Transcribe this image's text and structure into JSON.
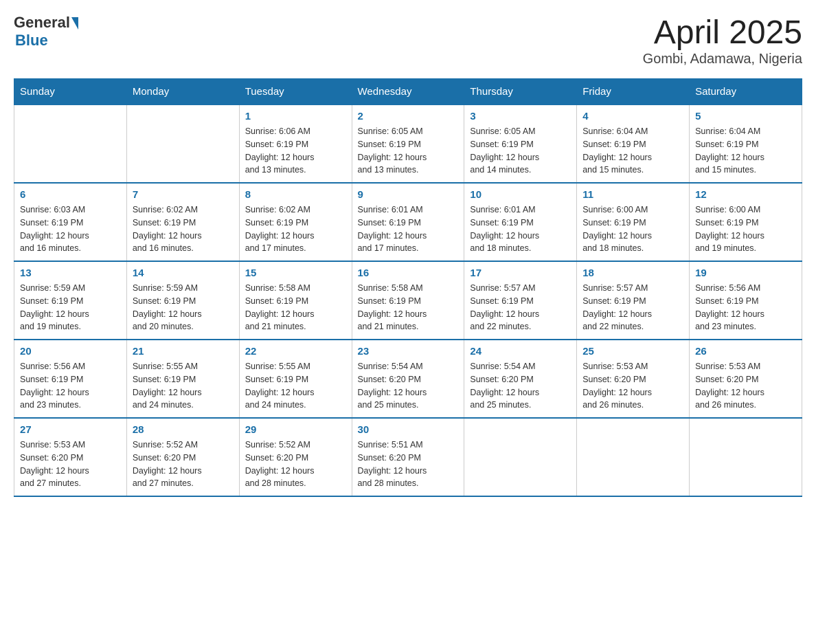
{
  "header": {
    "logo_general": "General",
    "logo_blue": "Blue",
    "title": "April 2025",
    "subtitle": "Gombi, Adamawa, Nigeria"
  },
  "columns": [
    "Sunday",
    "Monday",
    "Tuesday",
    "Wednesday",
    "Thursday",
    "Friday",
    "Saturday"
  ],
  "weeks": [
    [
      {
        "day": "",
        "info": ""
      },
      {
        "day": "",
        "info": ""
      },
      {
        "day": "1",
        "info": "Sunrise: 6:06 AM\nSunset: 6:19 PM\nDaylight: 12 hours\nand 13 minutes."
      },
      {
        "day": "2",
        "info": "Sunrise: 6:05 AM\nSunset: 6:19 PM\nDaylight: 12 hours\nand 13 minutes."
      },
      {
        "day": "3",
        "info": "Sunrise: 6:05 AM\nSunset: 6:19 PM\nDaylight: 12 hours\nand 14 minutes."
      },
      {
        "day": "4",
        "info": "Sunrise: 6:04 AM\nSunset: 6:19 PM\nDaylight: 12 hours\nand 15 minutes."
      },
      {
        "day": "5",
        "info": "Sunrise: 6:04 AM\nSunset: 6:19 PM\nDaylight: 12 hours\nand 15 minutes."
      }
    ],
    [
      {
        "day": "6",
        "info": "Sunrise: 6:03 AM\nSunset: 6:19 PM\nDaylight: 12 hours\nand 16 minutes."
      },
      {
        "day": "7",
        "info": "Sunrise: 6:02 AM\nSunset: 6:19 PM\nDaylight: 12 hours\nand 16 minutes."
      },
      {
        "day": "8",
        "info": "Sunrise: 6:02 AM\nSunset: 6:19 PM\nDaylight: 12 hours\nand 17 minutes."
      },
      {
        "day": "9",
        "info": "Sunrise: 6:01 AM\nSunset: 6:19 PM\nDaylight: 12 hours\nand 17 minutes."
      },
      {
        "day": "10",
        "info": "Sunrise: 6:01 AM\nSunset: 6:19 PM\nDaylight: 12 hours\nand 18 minutes."
      },
      {
        "day": "11",
        "info": "Sunrise: 6:00 AM\nSunset: 6:19 PM\nDaylight: 12 hours\nand 18 minutes."
      },
      {
        "day": "12",
        "info": "Sunrise: 6:00 AM\nSunset: 6:19 PM\nDaylight: 12 hours\nand 19 minutes."
      }
    ],
    [
      {
        "day": "13",
        "info": "Sunrise: 5:59 AM\nSunset: 6:19 PM\nDaylight: 12 hours\nand 19 minutes."
      },
      {
        "day": "14",
        "info": "Sunrise: 5:59 AM\nSunset: 6:19 PM\nDaylight: 12 hours\nand 20 minutes."
      },
      {
        "day": "15",
        "info": "Sunrise: 5:58 AM\nSunset: 6:19 PM\nDaylight: 12 hours\nand 21 minutes."
      },
      {
        "day": "16",
        "info": "Sunrise: 5:58 AM\nSunset: 6:19 PM\nDaylight: 12 hours\nand 21 minutes."
      },
      {
        "day": "17",
        "info": "Sunrise: 5:57 AM\nSunset: 6:19 PM\nDaylight: 12 hours\nand 22 minutes."
      },
      {
        "day": "18",
        "info": "Sunrise: 5:57 AM\nSunset: 6:19 PM\nDaylight: 12 hours\nand 22 minutes."
      },
      {
        "day": "19",
        "info": "Sunrise: 5:56 AM\nSunset: 6:19 PM\nDaylight: 12 hours\nand 23 minutes."
      }
    ],
    [
      {
        "day": "20",
        "info": "Sunrise: 5:56 AM\nSunset: 6:19 PM\nDaylight: 12 hours\nand 23 minutes."
      },
      {
        "day": "21",
        "info": "Sunrise: 5:55 AM\nSunset: 6:19 PM\nDaylight: 12 hours\nand 24 minutes."
      },
      {
        "day": "22",
        "info": "Sunrise: 5:55 AM\nSunset: 6:19 PM\nDaylight: 12 hours\nand 24 minutes."
      },
      {
        "day": "23",
        "info": "Sunrise: 5:54 AM\nSunset: 6:20 PM\nDaylight: 12 hours\nand 25 minutes."
      },
      {
        "day": "24",
        "info": "Sunrise: 5:54 AM\nSunset: 6:20 PM\nDaylight: 12 hours\nand 25 minutes."
      },
      {
        "day": "25",
        "info": "Sunrise: 5:53 AM\nSunset: 6:20 PM\nDaylight: 12 hours\nand 26 minutes."
      },
      {
        "day": "26",
        "info": "Sunrise: 5:53 AM\nSunset: 6:20 PM\nDaylight: 12 hours\nand 26 minutes."
      }
    ],
    [
      {
        "day": "27",
        "info": "Sunrise: 5:53 AM\nSunset: 6:20 PM\nDaylight: 12 hours\nand 27 minutes."
      },
      {
        "day": "28",
        "info": "Sunrise: 5:52 AM\nSunset: 6:20 PM\nDaylight: 12 hours\nand 27 minutes."
      },
      {
        "day": "29",
        "info": "Sunrise: 5:52 AM\nSunset: 6:20 PM\nDaylight: 12 hours\nand 28 minutes."
      },
      {
        "day": "30",
        "info": "Sunrise: 5:51 AM\nSunset: 6:20 PM\nDaylight: 12 hours\nand 28 minutes."
      },
      {
        "day": "",
        "info": ""
      },
      {
        "day": "",
        "info": ""
      },
      {
        "day": "",
        "info": ""
      }
    ]
  ]
}
